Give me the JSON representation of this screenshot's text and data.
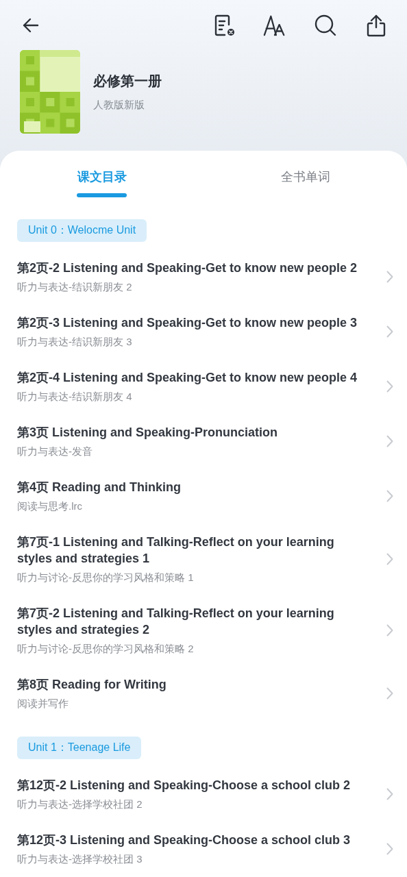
{
  "book": {
    "title": "必修第一册",
    "edition": "人教版新版"
  },
  "tabs": [
    {
      "label": "课文目录",
      "selected": true
    },
    {
      "label": "全书单词",
      "selected": false
    }
  ],
  "units": [
    {
      "label": "Unit 0：Welocme Unit",
      "lessons": [
        {
          "title": "第2页-2 Listening and Speaking-Get to know new people 2",
          "subtitle": "听力与表达-结识新朋友 2"
        },
        {
          "title": "第2页-3 Listening and Speaking-Get to know new people 3",
          "subtitle": "听力与表达-结识新朋友 3"
        },
        {
          "title": "第2页-4 Listening and Speaking-Get to know new people 4",
          "subtitle": "听力与表达-结识新朋友 4"
        },
        {
          "title": "第3页 Listening and Speaking-Pronunciation",
          "subtitle": "听力与表达-发音"
        },
        {
          "title": "第4页 Reading and Thinking",
          "subtitle": "阅读与思考.lrc"
        },
        {
          "title": "第7页-1 Listening and Talking-Reflect on your learning styles and strategies 1",
          "subtitle": "听力与讨论-反思你的学习风格和策略 1"
        },
        {
          "title": "第7页-2 Listening and Talking-Reflect on your learning styles and strategies 2",
          "subtitle": "听力与讨论-反思你的学习风格和策略 2"
        },
        {
          "title": "第8页 Reading for Writing",
          "subtitle": "阅读并写作"
        }
      ]
    },
    {
      "label": "Unit 1：Teenage Life",
      "lessons": [
        {
          "title": "第12页-2 Listening and Speaking-Choose a school club 2",
          "subtitle": "听力与表达-选择学校社团 2"
        },
        {
          "title": "第12页-3 Listening and Speaking-Choose a school club 3",
          "subtitle": "听力与表达-选择学校社团 3"
        }
      ]
    }
  ]
}
